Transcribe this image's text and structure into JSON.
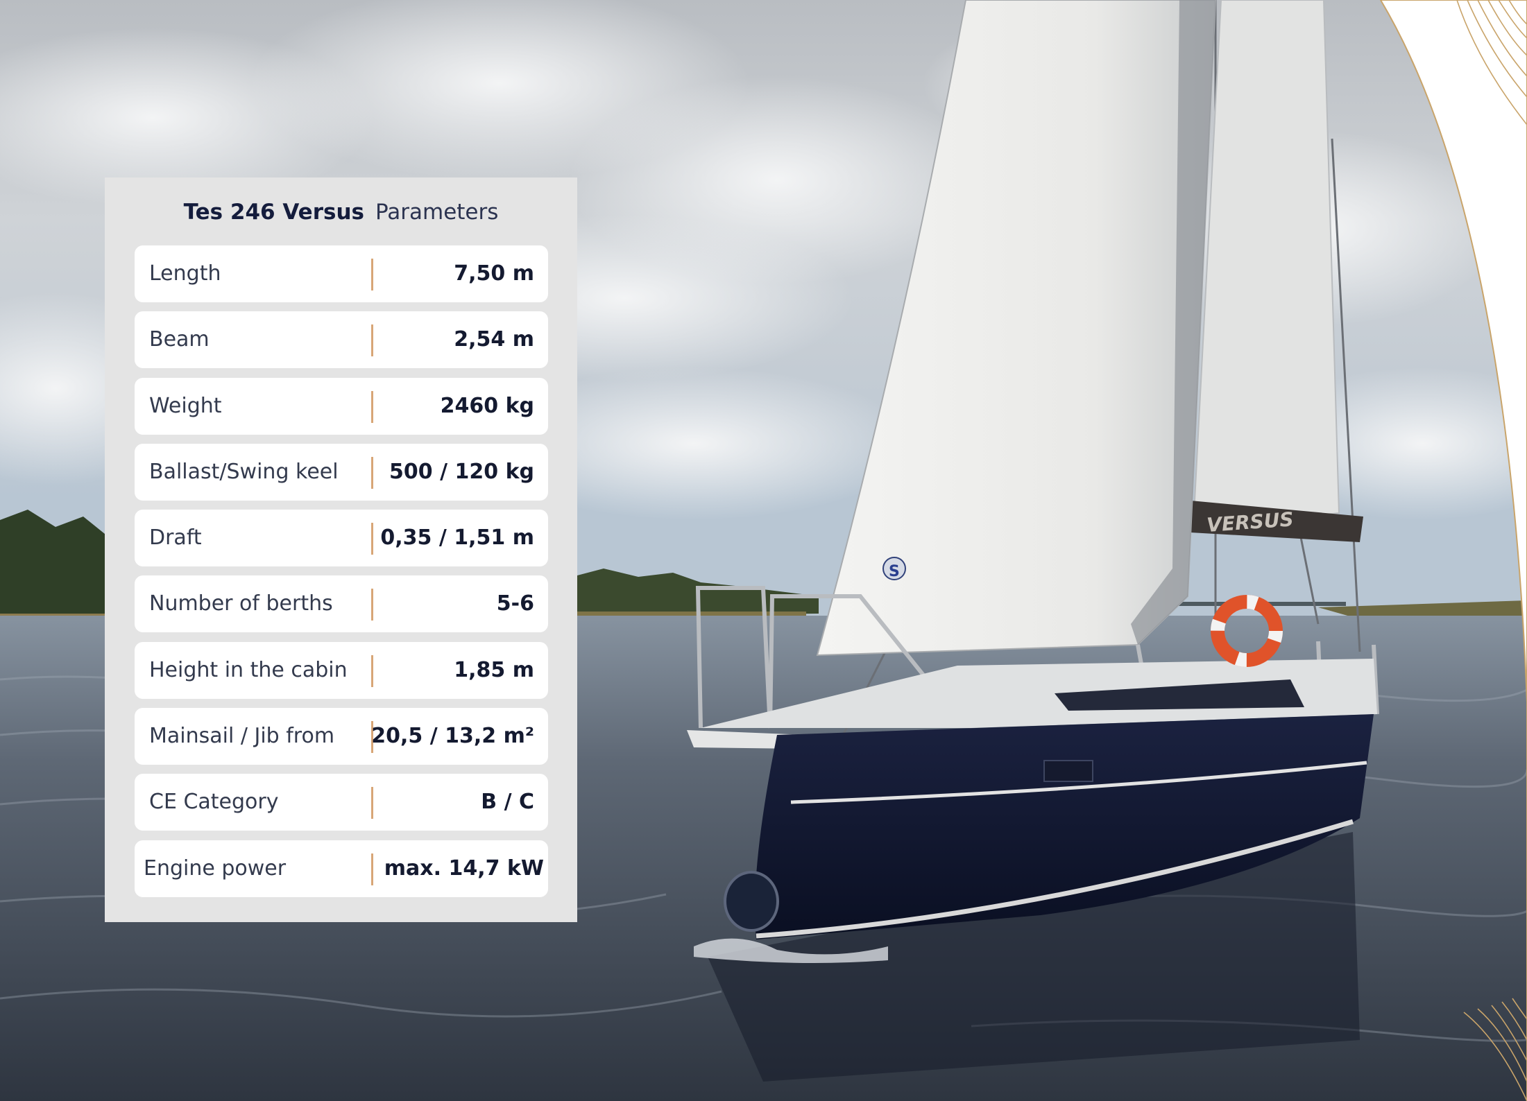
{
  "spec_card": {
    "model": "Tes 246 Versus",
    "title_suffix": "Parameters",
    "rows": [
      {
        "label": "Length",
        "value": "7,50 m"
      },
      {
        "label": "Beam",
        "value": "2,54 m"
      },
      {
        "label": "Weight",
        "value": "2460 kg"
      },
      {
        "label": "Ballast/Swing keel",
        "value": "500 /  120 kg"
      },
      {
        "label": "Draft",
        "value": "0,35 / 1,51 m"
      },
      {
        "label": "Number of berths",
        "value": "5-6"
      },
      {
        "label": "Height in the cabin",
        "value": "1,85 m"
      },
      {
        "label": "Mainsail / Jib from",
        "value": "20,5 / 13,2 m²"
      },
      {
        "label": "CE Category",
        "value": "B / C"
      },
      {
        "label": "Engine power",
        "value": "max. 14,7 kW"
      }
    ]
  },
  "photo": {
    "sail_text": "VERSUS",
    "sail_logo": "S"
  },
  "colors": {
    "card_bg": "#e4e4e4",
    "divider": "#d8a677",
    "text_dark": "#141a30",
    "hull": "#0f1530",
    "gold_lines": "#c9a46a"
  }
}
